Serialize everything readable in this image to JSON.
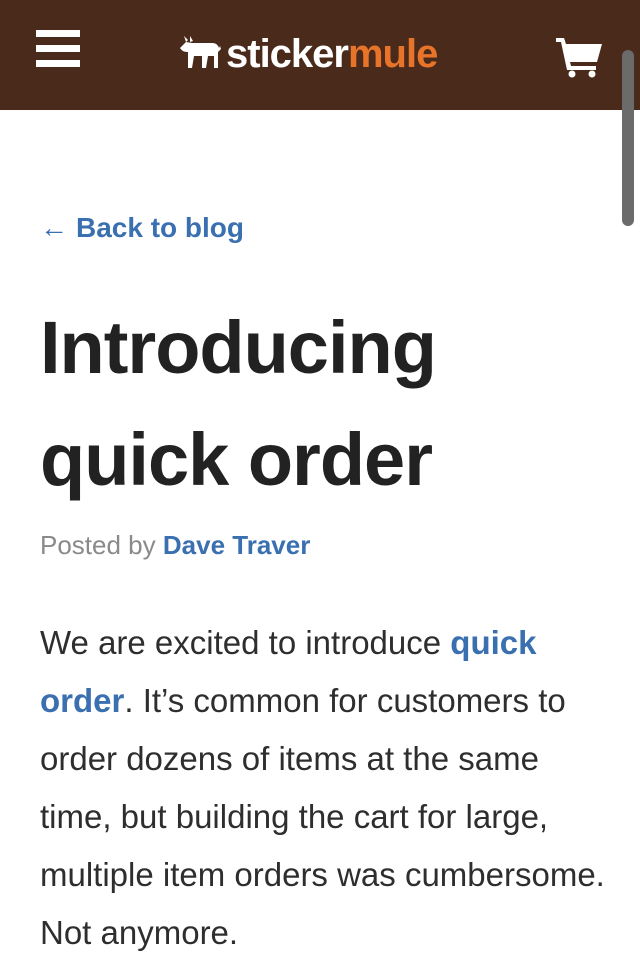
{
  "header": {
    "brand_part1": "sticker",
    "brand_part2": "mule",
    "menu_icon": "hamburger-menu-icon",
    "cart_icon": "shopping-cart-icon",
    "logo_icon": "mule-logo-icon",
    "background_color": "#4a2a1a",
    "brand_accent_color": "#e8742a"
  },
  "nav": {
    "back_arrow": "←",
    "back_label": "Back to blog"
  },
  "article": {
    "title": "Introducing quick order",
    "byline_prefix": "Posted by",
    "author": "Dave Traver",
    "body_intro": "We are excited to introduce ",
    "body_link": "quick order",
    "body_rest": ". It’s common for customers to order dozens of items at the same time, but building the cart for large, multiple item orders was cumbersome. Not anymore."
  },
  "colors": {
    "link": "#3a6fb0",
    "text": "#2e2e2e",
    "muted": "#8a8a8a"
  }
}
